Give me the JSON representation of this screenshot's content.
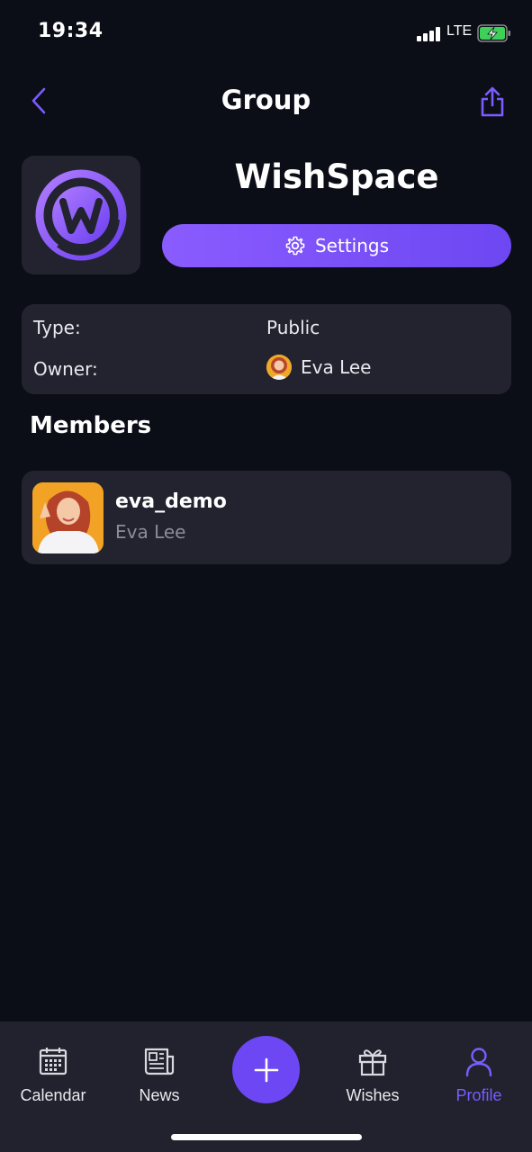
{
  "status_bar": {
    "time": "19:34",
    "network": "LTE"
  },
  "header": {
    "title": "Group",
    "back_icon": "chevron-left-icon",
    "share_icon": "share-icon"
  },
  "group": {
    "name": "WishSpace",
    "logo_icon": "wishspace-logo",
    "settings_label": "Settings",
    "settings_icon": "gear-icon"
  },
  "info": {
    "type_label": "Type:",
    "type_value": "Public",
    "owner_label": "Owner:",
    "owner_name": "Eva Lee"
  },
  "members": {
    "title": "Members",
    "items": [
      {
        "username": "eva_demo",
        "full_name": "Eva Lee"
      }
    ]
  },
  "tab_bar": {
    "tabs": [
      {
        "label": "Calendar",
        "icon": "calendar-icon"
      },
      {
        "label": "News",
        "icon": "newspaper-icon"
      },
      {
        "label": "Wishes",
        "icon": "gift-icon"
      },
      {
        "label": "Profile",
        "icon": "profile-icon"
      }
    ],
    "active": "Profile",
    "fab_icon": "plus-icon"
  },
  "colors": {
    "background": "#0c0e17",
    "card": "#22232f",
    "accent": "#7a5cff",
    "tab_bar": "#21222d"
  }
}
